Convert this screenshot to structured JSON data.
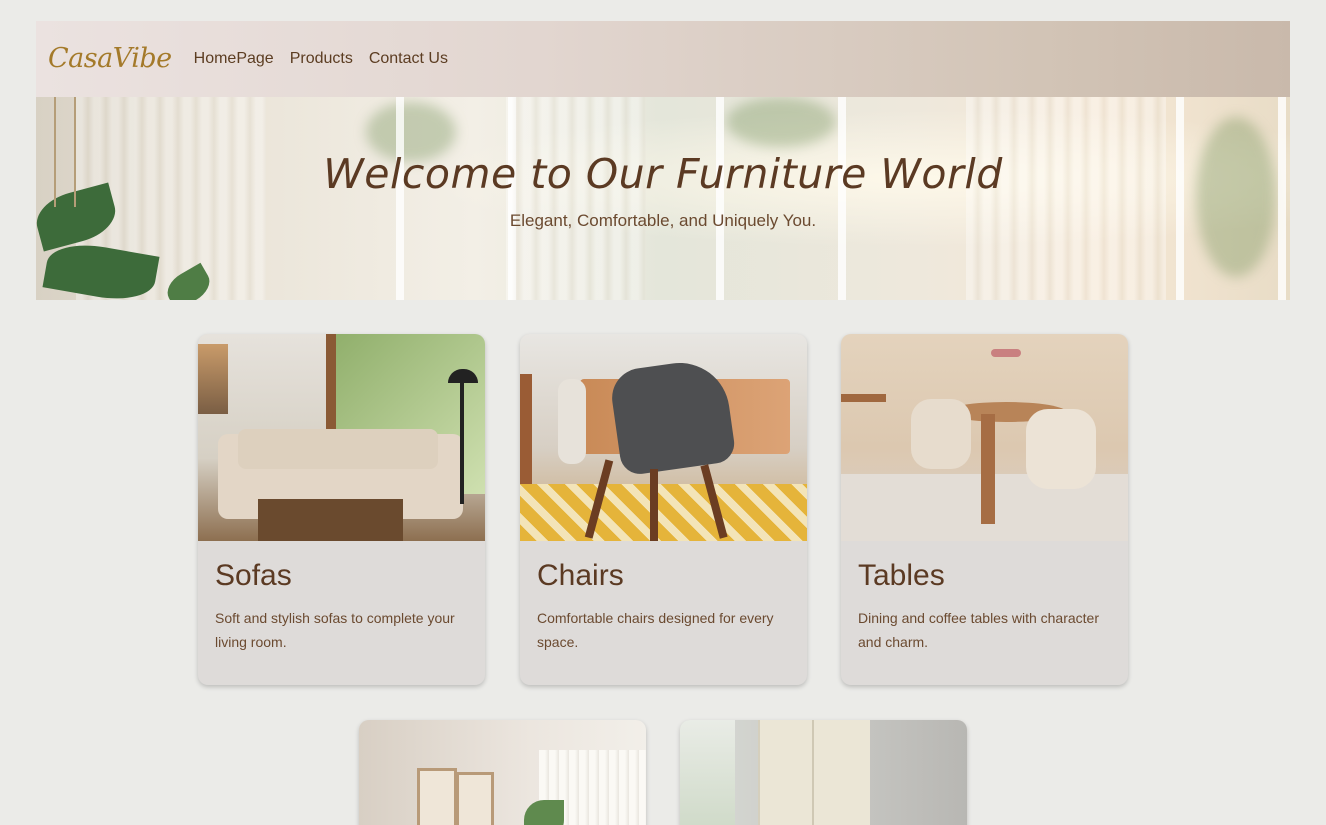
{
  "nav": {
    "logo": "CasaVibe",
    "links": [
      "HomePage",
      "Products",
      "Contact Us"
    ]
  },
  "hero": {
    "title": "Welcome to Our Furniture World",
    "subtitle": "Elegant, Comfortable, and Uniquely You."
  },
  "cards": [
    {
      "title": "Sofas",
      "description": "Soft and stylish sofas to complete your living room."
    },
    {
      "title": "Chairs",
      "description": "Comfortable chairs designed for every space."
    },
    {
      "title": "Tables",
      "description": "Dining and coffee tables with character and charm."
    }
  ],
  "colors": {
    "page_bg": "#ebebe8",
    "logo": "#a47a2a",
    "text_brown": "#5b3a23",
    "card_bg": "#dedbd9"
  }
}
